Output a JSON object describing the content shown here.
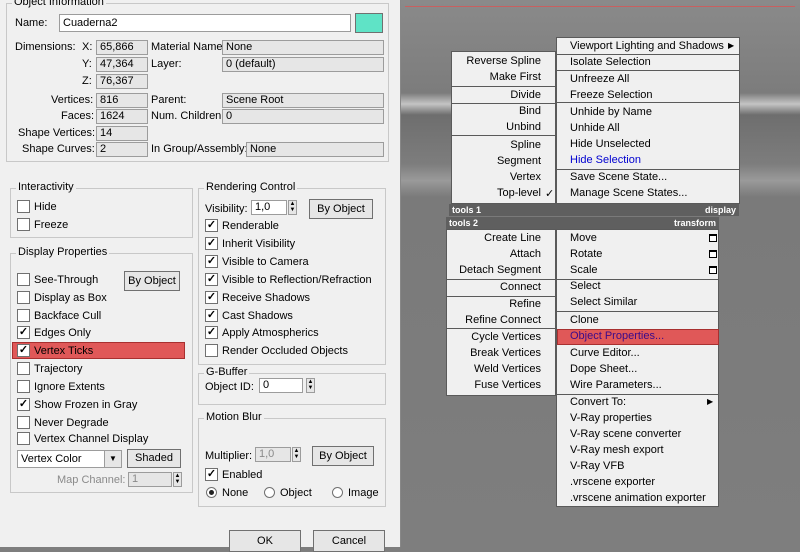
{
  "object_info": {
    "legend": "Object Information",
    "name_label": "Name:",
    "name_value": "Cuaderna2",
    "color_swatch": "#5fe3c6",
    "dimensions_label": "Dimensions:",
    "x_label": "X:",
    "x_value": "65,866",
    "y_label": "Y:",
    "y_value": "47,364",
    "z_label": "Z:",
    "z_value": "76,367",
    "vertices_label": "Vertices:",
    "vertices_value": "816",
    "faces_label": "Faces:",
    "faces_value": "1624",
    "shape_vertices_label": "Shape Vertices:",
    "shape_vertices_value": "14",
    "shape_curves_label": "Shape Curves:",
    "shape_curves_value": "2",
    "material_label": "Material Name:",
    "material_value": "None",
    "layer_label": "Layer:",
    "layer_value": "0 (default)",
    "parent_label": "Parent:",
    "parent_value": "Scene Root",
    "children_label": "Num. Children:",
    "children_value": "0",
    "group_label": "In Group/Assembly:",
    "group_value": "None"
  },
  "interactivity": {
    "legend": "Interactivity",
    "hide": {
      "label": "Hide",
      "checked": false
    },
    "freeze": {
      "label": "Freeze",
      "checked": false
    }
  },
  "display_properties": {
    "legend": "Display Properties",
    "by_object": "By Object",
    "items": [
      {
        "label": "See-Through",
        "checked": false
      },
      {
        "label": "Display as Box",
        "checked": false
      },
      {
        "label": "Backface Cull",
        "checked": false
      },
      {
        "label": "Edges Only",
        "checked": true
      },
      {
        "label": "Vertex Ticks",
        "checked": true
      },
      {
        "label": "Trajectory",
        "checked": false
      },
      {
        "label": "Ignore Extents",
        "checked": false
      },
      {
        "label": "Show Frozen in Gray",
        "checked": true
      },
      {
        "label": "Never Degrade",
        "checked": false
      },
      {
        "label": "Vertex Channel Display",
        "checked": false
      }
    ],
    "vertex_color": "Vertex Color",
    "shaded": "Shaded",
    "map_channel_label": "Map Channel:",
    "map_channel_value": "1"
  },
  "rendering_control": {
    "legend": "Rendering Control",
    "visibility_label": "Visibility:",
    "visibility_value": "1,0",
    "by_object": "By Object",
    "items": [
      {
        "label": "Renderable",
        "checked": true
      },
      {
        "label": "Inherit Visibility",
        "checked": true
      },
      {
        "label": "Visible to Camera",
        "checked": true
      },
      {
        "label": "Visible to Reflection/Refraction",
        "checked": true
      },
      {
        "label": "Receive Shadows",
        "checked": true
      },
      {
        "label": "Cast Shadows",
        "checked": true
      },
      {
        "label": "Apply Atmospherics",
        "checked": true
      },
      {
        "label": "Render Occluded Objects",
        "checked": false
      }
    ]
  },
  "gbuffer": {
    "legend": "G-Buffer",
    "object_id_label": "Object ID:",
    "object_id_value": "0"
  },
  "motion_blur": {
    "legend": "Motion Blur",
    "multiplier_label": "Multiplier:",
    "multiplier_value": "1,0",
    "by_object": "By Object",
    "enabled": {
      "label": "Enabled",
      "checked": true
    },
    "radios": [
      {
        "label": "None",
        "selected": true
      },
      {
        "label": "Object",
        "selected": false
      },
      {
        "label": "Image",
        "selected": false
      }
    ]
  },
  "footer": {
    "ok": "OK",
    "cancel": "Cancel"
  },
  "quad_menu": {
    "tools1_label": "tools 1",
    "display_label": "display",
    "tools2_label": "tools 2",
    "transform_label": "transform",
    "tools1_items": [
      "Reverse Spline",
      "Make First",
      "Divide",
      "Bind",
      "Unbind",
      "Spline",
      "Segment",
      "Vertex",
      "Top-level"
    ],
    "display_items": [
      "Viewport Lighting and Shadows",
      "Isolate Selection",
      "Unfreeze All",
      "Freeze Selection",
      "Unhide by Name",
      "Unhide All",
      "Hide Unselected",
      "Hide Selection",
      "Save Scene State...",
      "Manage Scene States..."
    ],
    "tools2_items": [
      "Create Line",
      "Attach",
      "Detach Segment",
      "Connect",
      "Refine",
      "Refine Connect",
      "Cycle Vertices",
      "Break Vertices",
      "Weld Vertices",
      "Fuse Vertices"
    ],
    "transform_items": [
      "Move",
      "Rotate",
      "Scale",
      "Select",
      "Select Similar",
      "Clone",
      "Object Properties...",
      "Curve Editor...",
      "Dope Sheet...",
      "Wire Parameters...",
      "Convert To:",
      "V-Ray properties",
      "V-Ray scene converter",
      "V-Ray mesh export",
      "V-Ray VFB",
      ".vrscene exporter",
      ".vrscene animation exporter"
    ],
    "highlight_color": "#e05858",
    "link_color": "#0000d0"
  }
}
